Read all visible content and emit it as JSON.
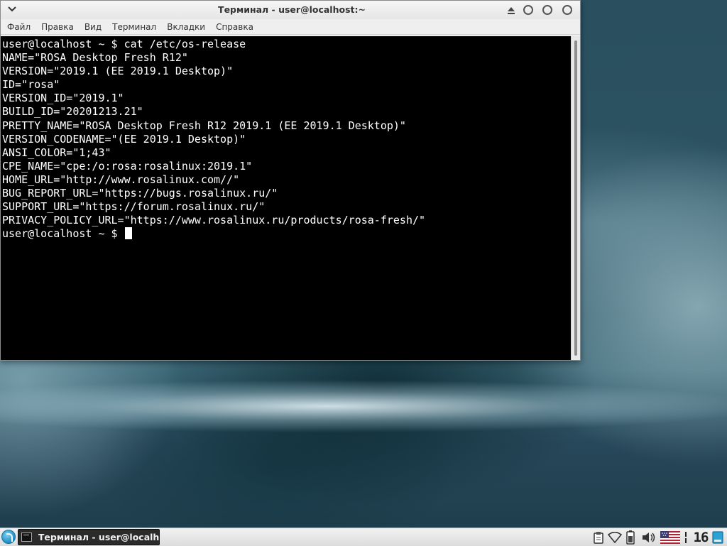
{
  "window": {
    "title": "Терминал - user@localhost:~",
    "menu": [
      "Файл",
      "Правка",
      "Вид",
      "Терминал",
      "Вкладки",
      "Справка"
    ]
  },
  "terminal": {
    "lines": [
      "user@localhost ~ $ cat /etc/os-release",
      "NAME=\"ROSA Desktop Fresh R12\"",
      "VERSION=\"2019.1 (EE 2019.1 Desktop)\"",
      "ID=\"rosa\"",
      "VERSION_ID=\"2019.1\"",
      "BUILD_ID=\"20201213.21\"",
      "PRETTY_NAME=\"ROSA Desktop Fresh R12 2019.1 (EE 2019.1 Desktop)\"",
      "VERSION_CODENAME=\"(EE 2019.1 Desktop)\"",
      "ANSI_COLOR=\"1;43\"",
      "CPE_NAME=\"cpe:/o:rosa:rosalinux:2019.1\"",
      "HOME_URL=\"http://www.rosalinux.com//\"",
      "BUG_REPORT_URL=\"https://bugs.rosalinux.ru/\"",
      "SUPPORT_URL=\"https://forum.rosalinux.ru/\"",
      "PRIVACY_POLICY_URL=\"https://www.rosalinux.ru/products/rosa-fresh/\""
    ],
    "prompt": "user@localhost ~ $ "
  },
  "taskbar": {
    "task_label": "Терминал - user@localh...",
    "clock": "16"
  },
  "icons": {
    "window_menu": "chevron-down-icon",
    "keep_above": "keep-above-icon",
    "minimize": "minimize-icon",
    "maximize": "maximize-icon",
    "close": "close-icon",
    "start": "rosa-start-icon",
    "task": "terminal-icon",
    "clipboard": "clipboard-icon",
    "network": "wifi-icon",
    "battery": "battery-icon",
    "volume": "volume-icon",
    "keyboard_layout": "us-flag-icon",
    "show_desktop": "show-desktop-icon"
  },
  "colors": {
    "terminal_bg": "#000000",
    "terminal_fg": "#ffffff",
    "taskbar_active": "#2b2b2b",
    "start_accent": "#1b8cc2"
  }
}
